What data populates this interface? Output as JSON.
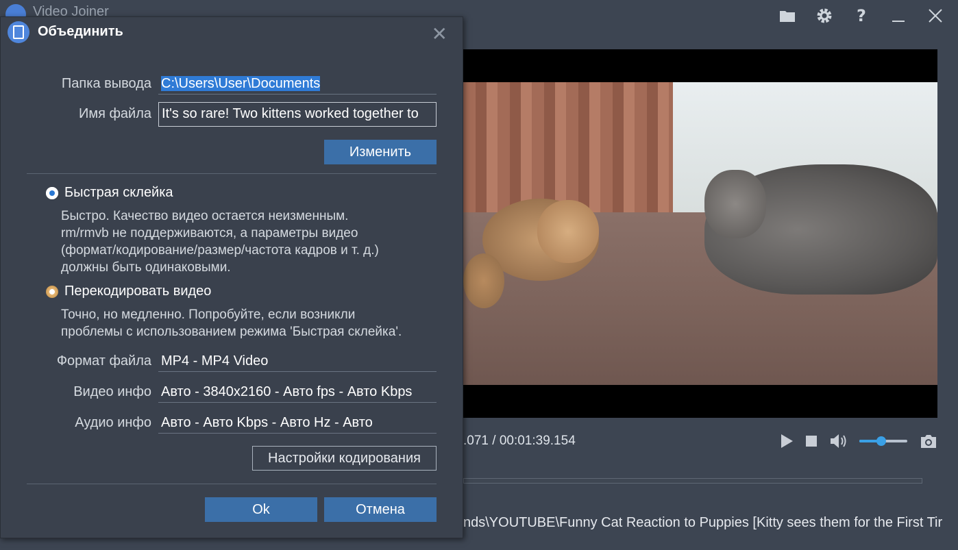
{
  "app": {
    "title": "Video Joiner"
  },
  "top_icons": [
    "folder-icon",
    "gear-icon",
    "help-icon",
    "minimize-icon",
    "close-icon"
  ],
  "player": {
    "time_text": ".071 / 00:01:39.154",
    "volume_level": 0.45,
    "file_path": "nds\\YOUTUBE\\Funny Cat Reaction to Puppies [Kitty sees them for the First Tir"
  },
  "dialog": {
    "title": "Объединить",
    "output_folder_label": "Папка вывода",
    "output_folder_value": "C:\\Users\\User\\Documents",
    "filename_label": "Имя файла",
    "filename_value": "It's so rare! Two kittens worked together to",
    "change_button": "Изменить",
    "fast_join_label": "Быстрая склейка",
    "fast_join_desc": [
      "Быстро. Качество видео остается неизменным.",
      "rm/rmvb не поддерживаются, а параметры видео",
      "(формат/кодирование/размер/частота кадров и т. д.)",
      "должны быть одинаковыми."
    ],
    "reencode_label": "Перекодировать видео",
    "reencode_desc": [
      "Точно, но медленно. Попробуйте, если возникли",
      "проблемы с использованием режима 'Быстрая склейка'."
    ],
    "format_label": "Формат файла",
    "format_value": "MP4 - MP4 Video",
    "video_info_label": "Видео инфо",
    "video_info_value": "Авто - 3840x2160 - Авто fps - Авто Kbps",
    "audio_info_label": "Аудио инфо",
    "audio_info_value": "Авто - Авто Kbps - Авто Hz - Авто",
    "encoding_settings_button": "Настройки кодирования",
    "ok_button": "Ok",
    "cancel_button": "Отмена"
  },
  "colors": {
    "accent": "#3b6fa8",
    "background": "#3d4552",
    "selection": "#2f7bd6"
  }
}
